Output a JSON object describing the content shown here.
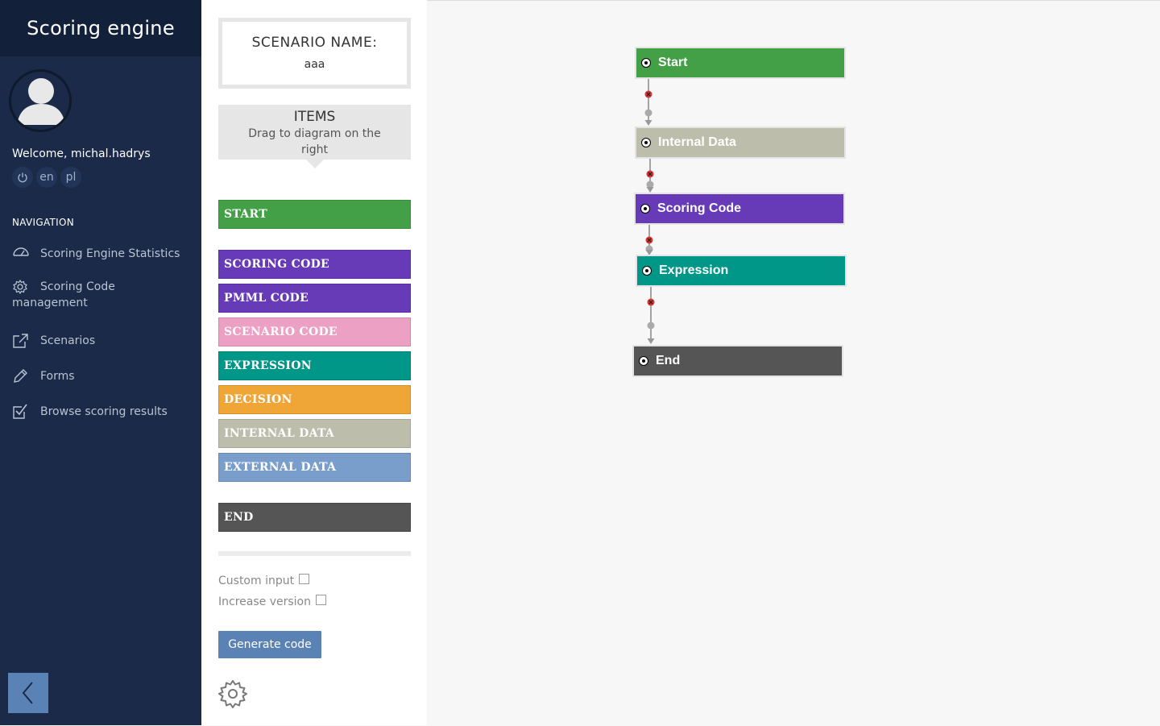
{
  "app": {
    "title": "Scoring engine"
  },
  "user": {
    "welcome": "Welcome, michal.hadrys",
    "languages": [
      "en",
      "pl"
    ]
  },
  "navigation": {
    "title": "NAVIGATION",
    "items": [
      {
        "label": "Scoring Engine Statistics",
        "icon": "dashboard-icon"
      },
      {
        "label": "Scoring Code management",
        "icon": "gear-icon"
      },
      {
        "label": "Scenarios",
        "icon": "external-link-icon"
      },
      {
        "label": "Forms",
        "icon": "pencil-icon"
      },
      {
        "label": "Browse scoring results",
        "icon": "checkbox-icon"
      }
    ]
  },
  "scenario": {
    "name_label": "SCENARIO NAME:",
    "name_value": "aaa"
  },
  "items_panel": {
    "title": "ITEMS",
    "subtitle": "Drag to diagram on the right"
  },
  "palette": [
    {
      "label": "START",
      "color": "#43a047"
    },
    {
      "label": "SCORING CODE",
      "color": "#673ab7"
    },
    {
      "label": "PMML CODE",
      "color": "#673ab7"
    },
    {
      "label": "SCENARIO CODE",
      "color": "#eba0c4"
    },
    {
      "label": "EXPRESSION",
      "color": "#009688"
    },
    {
      "label": "DECISION",
      "color": "#f0a537"
    },
    {
      "label": "INTERNAL DATA",
      "color": "#bcbeab"
    },
    {
      "label": "EXTERNAL DATA",
      "color": "#7a9ecb"
    },
    {
      "label": "END",
      "color": "#555555"
    }
  ],
  "options": {
    "custom_input_label": "Custom input",
    "custom_input_checked": false,
    "increase_version_label": "Increase version",
    "increase_version_checked": false
  },
  "actions": {
    "generate_label": "Generate code"
  },
  "diagram": {
    "nodes": [
      {
        "label": "Start",
        "color": "#43a047"
      },
      {
        "label": "Internal Data",
        "color": "#bcbeab"
      },
      {
        "label": "Scoring Code",
        "color": "#673ab7"
      },
      {
        "label": "Expression",
        "color": "#009688"
      },
      {
        "label": "End",
        "color": "#555555"
      }
    ]
  }
}
